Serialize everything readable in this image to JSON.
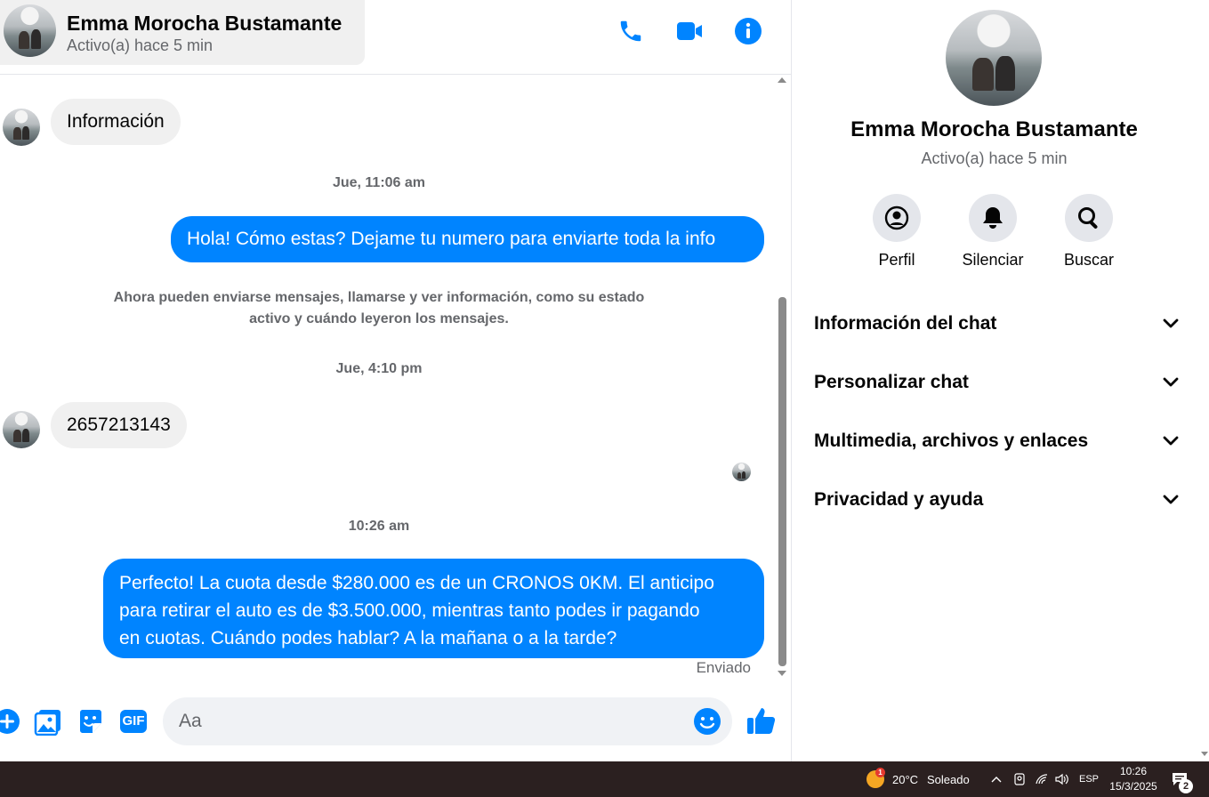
{
  "header": {
    "contact_name": "Emma Morocha Bustamante",
    "contact_status": "Activo(a) hace 5 min",
    "icons": [
      "phone-icon",
      "video-camera-icon",
      "info-icon"
    ]
  },
  "messages": {
    "incoming_1": "Información",
    "timestamp_1": "Jue, 11:06 am",
    "outgoing_1": "Hola! Cómo estas? Dejame tu numero para enviarte toda la info",
    "system_note_line_1": "Ahora pueden enviarse mensajes, llamarse y ver información, como su estado",
    "system_note_line_2": "activo y cuándo leyeron los mensajes.",
    "timestamp_2": "Jue, 4:10 pm",
    "incoming_2": "2657213143",
    "timestamp_3": "10:26 am",
    "outgoing_2_line_1": "Perfecto! La cuota desde $280.000 es de un CRONOS 0KM. El anticipo",
    "outgoing_2_line_2": "para retirar el auto es de $3.500.000, mientras tanto podes ir pagando",
    "outgoing_2_line_3": "en cuotas. Cuándo podes hablar? A la mañana o a la tarde?",
    "sent_status": "Enviado"
  },
  "composer": {
    "placeholder": "Aa",
    "icons": [
      "plus-icon",
      "image-icon",
      "sticker-icon",
      "gif-icon",
      "emoji-icon",
      "thumbs-up-icon"
    ],
    "gif_label": "GIF"
  },
  "info_panel": {
    "name": "Emma Morocha Bustamante",
    "status": "Activo(a) hace 5 min",
    "actions": [
      {
        "label": "Perfil",
        "icon": "profile-icon"
      },
      {
        "label": "Silenciar",
        "icon": "bell-icon"
      },
      {
        "label": "Buscar",
        "icon": "search-icon"
      }
    ],
    "sections": [
      {
        "label": "Información del chat"
      },
      {
        "label": "Personalizar chat"
      },
      {
        "label": "Multimedia, archivos y enlaces"
      },
      {
        "label": "Privacidad y ayuda"
      }
    ]
  },
  "taskbar": {
    "weather_temp": "20°C",
    "weather_text": "Soleado",
    "weather_badge": "1",
    "language": "ESP",
    "time": "10:26",
    "date": "15/3/2025",
    "notification_count": "2"
  },
  "colors": {
    "accent": "#0084ff",
    "bubble_in": "#f0f0f0",
    "secondary_text": "#65676b",
    "taskbar": "#2b2020"
  }
}
